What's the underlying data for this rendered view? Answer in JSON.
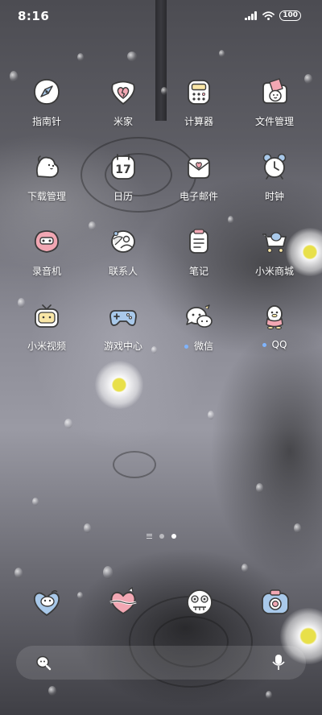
{
  "status_bar": {
    "time": "8:16",
    "battery": "100"
  },
  "apps": [
    {
      "label": "指南针",
      "icon": "compass-icon"
    },
    {
      "label": "米家",
      "icon": "mijia-heart-icon"
    },
    {
      "label": "计算器",
      "icon": "calculator-icon"
    },
    {
      "label": "文件管理",
      "icon": "file-manager-icon"
    },
    {
      "label": "下载管理",
      "icon": "download-manager-icon"
    },
    {
      "label": "日历",
      "icon": "calendar-icon",
      "date": "17"
    },
    {
      "label": "电子邮件",
      "icon": "email-icon"
    },
    {
      "label": "时钟",
      "icon": "alarm-clock-icon"
    },
    {
      "label": "录音机",
      "icon": "recorder-icon"
    },
    {
      "label": "联系人",
      "icon": "contacts-icon"
    },
    {
      "label": "笔记",
      "icon": "notes-icon"
    },
    {
      "label": "小米商城",
      "icon": "mi-store-cart-icon"
    },
    {
      "label": "小米视频",
      "icon": "mi-video-tv-icon"
    },
    {
      "label": "游戏中心",
      "icon": "gamepad-icon"
    },
    {
      "label": "微信",
      "icon": "wechat-icon",
      "new": true
    },
    {
      "label": "QQ",
      "icon": "qq-penguin-icon",
      "new": true
    }
  ],
  "page_indicator": {
    "pages": 2,
    "active": 2
  },
  "dock": [
    {
      "icon": "phone-icon"
    },
    {
      "icon": "messages-icon"
    },
    {
      "icon": "browser-icon"
    },
    {
      "icon": "camera-icon"
    }
  ],
  "colors": {
    "icon_fill": "#ffffff",
    "icon_outline": "#3a3a3a",
    "accent_pink": "#f2a7b3",
    "accent_blue": "#a9c9ea",
    "new_dot": "#7fb4ff"
  }
}
